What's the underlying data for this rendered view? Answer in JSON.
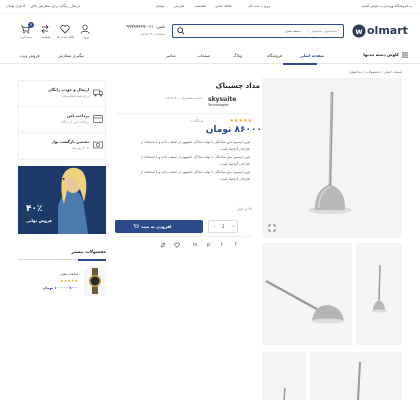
{
  "topbar": {
    "right_text": "به فروشگاه وودمارت خوش آمدید",
    "links": [
      "ورود / ثبت نام",
      "علاقه مندی",
      "مقایسه",
      "فارسی",
      "تومان"
    ],
    "left_text": "ارسال رایگان برای سفارش بالای ۵۰۰ هزار تومان"
  },
  "header": {
    "logo": "olmart",
    "search_placeholder": "جستجوی محصول ...",
    "search_category": "دسته بندی",
    "phone_label": "تلفن: ۰۲۱-۹۹۹۹۹۹۹۹",
    "phone_sub": "پشتیبانی ۲۴ ساعته",
    "icons": [
      {
        "name": "account",
        "label": "ورود"
      },
      {
        "name": "wishlist",
        "label": "علاقه مندی ها"
      },
      {
        "name": "compare",
        "label": "مقایسه"
      },
      {
        "name": "cart",
        "label": "سبد خرید",
        "badge": "0"
      }
    ]
  },
  "nav": {
    "category_button": "کاوش دسته بندیها",
    "items": [
      "صفحه اصلی",
      "فروشگاه",
      "وبلاگ",
      "صفحات",
      "عناصر"
    ],
    "right_links": [
      "پیگیری سفارش",
      "فروش ویژه"
    ]
  },
  "breadcrumb": "صفحه اصلی / محصولات / ساعتهای",
  "product": {
    "title": "مداد چسبناک",
    "brand": "skysuite",
    "brand_sub": "Technologies",
    "sku_label": "شناسه محصول: ۶۸۷۳۰۸۰۰",
    "rating_text": "(۱ دیدگاه)",
    "rating": 5,
    "price": "۸۶۰۰۰ تومان",
    "desc_lines": [
      "لورم ایپسوم متن ساختگی با تولید سادگی نامفهوم از صنعت چاپ و با استفاده از",
      "طراحان گرافیک است.",
      "لورم ایپسوم متن ساختگی با تولید سادگی نامفهوم از صنعت چاپ و با استفاده از",
      "طراحان گرافیک است.",
      "لورم ایپسوم متن ساختگی با تولید سادگی نامفهوم از صنعت چاپ و با استفاده از",
      "طراحان گرافیک است."
    ],
    "stock": "۹۷ در انبار",
    "add_to_cart": "افزودن به سبد",
    "qty": "1"
  },
  "features": [
    {
      "title": "ارسال و عودت رایگان",
      "sub": "برای همه سفارشات"
    },
    {
      "title": "پرداخت امن",
      "sub": "پرداخت امن از درگاه"
    },
    {
      "title": "تضمین بازگشت پول",
      "sub": "تا ۳۰ روز بعد"
    }
  ],
  "banner": {
    "percent": "۴۰٪",
    "label": "فروش نهایی"
  },
  "more_products": {
    "title": "محصولات بیشتر",
    "item_name": "ساعت مچی",
    "item_price": "۷۰۰۰ - ۱۰۰۰۰ تومان"
  }
}
